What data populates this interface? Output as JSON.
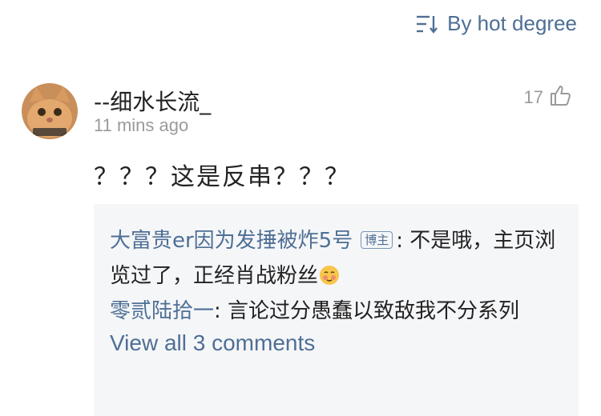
{
  "sort": {
    "label": "By hot degree",
    "icon": "sort-icon"
  },
  "comment": {
    "username": "--细水长流_",
    "timestamp": "11 mins ago",
    "likes": "17",
    "text": "？？？这是反串？？？",
    "avatar_icon": "cat-avatar"
  },
  "replies": [
    {
      "author": "大富贵er因为发捶被炸5号",
      "badge": "博主",
      "separator": ": ",
      "text": "不是哦，主页浏览过了，正经肖战粉丝",
      "emoji": "emoji-blush"
    },
    {
      "author": "零贰陆拾一",
      "separator": ": ",
      "text": "言论过分愚蠢以致敌我不分系列"
    }
  ],
  "view_all_label": "View all 3 comments",
  "colors": {
    "link": "#4e6f95",
    "muted": "#9a9a9a",
    "reply_bg": "#f5f6f8"
  }
}
